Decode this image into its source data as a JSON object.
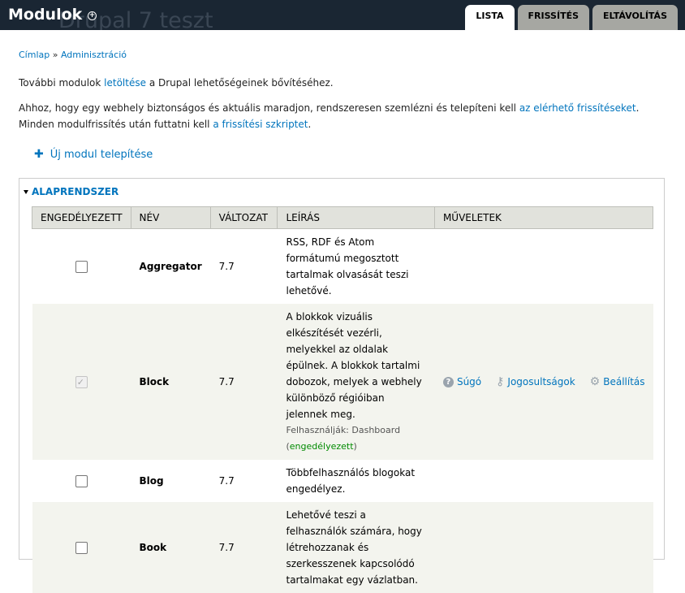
{
  "header": {
    "site_name": "Drupal 7 teszt",
    "page_title": "Modulok",
    "tabs": [
      {
        "label": "LISTA",
        "active": true
      },
      {
        "label": "FRISSÍTÉS",
        "active": false
      },
      {
        "label": "ELTÁVOLÍTÁS",
        "active": false
      }
    ]
  },
  "breadcrumb": {
    "home": "Címlap",
    "separator": "»",
    "admin": "Adminisztráció"
  },
  "intro": {
    "p1_before": "További modulok ",
    "p1_link": "letöltése",
    "p1_after": " a Drupal lehetőségeinek bővítéséhez.",
    "p2_before": "Ahhoz, hogy egy webhely biztonságos és aktuális maradjon, rendszeresen szemlézni és telepíteni kell ",
    "p2_link1": "az elérhető frissítéseket",
    "p2_middle": ". Minden modulfrissítés után futtatni kell ",
    "p2_link2": "a frissítési szkriptet",
    "p2_after": "."
  },
  "install_link": "Új modul telepítése",
  "fieldset": {
    "legend": "ALAPRENDSZER",
    "columns": [
      "ENGEDÉLYEZETT",
      "NÉV",
      "VÁLTOZAT",
      "LEÍRÁS",
      "MŰVELETEK"
    ],
    "rows": [
      {
        "name": "Aggregator",
        "version": "7.7",
        "description": "RSS, RDF és Atom formátumú megosztott tartalmak olvasását teszi lehetővé."
      },
      {
        "name": "Block",
        "version": "7.7",
        "description": "A blokkok vizuális elkészítését vezérli, melyekkel az oldalak épülnek. A blokkok tartalmi dobozok, melyek a webhely különböző régióiban jelennek meg.",
        "requires_label": "Felhasználják: Dashboard",
        "requires_status": "engedélyezett",
        "ops": {
          "help": "Súgó",
          "permissions": "Jogosultságok",
          "configure": "Beállítás"
        }
      },
      {
        "name": "Blog",
        "version": "7.7",
        "description": "Többfelhasználós blogokat engedélyez."
      },
      {
        "name": "Book",
        "version": "7.7",
        "description": "Lehetővé teszi a felhasználók számára, hogy létrehozzanak és szerkesszenek kapcsolódó tartalmakat egy vázlatban."
      }
    ]
  }
}
